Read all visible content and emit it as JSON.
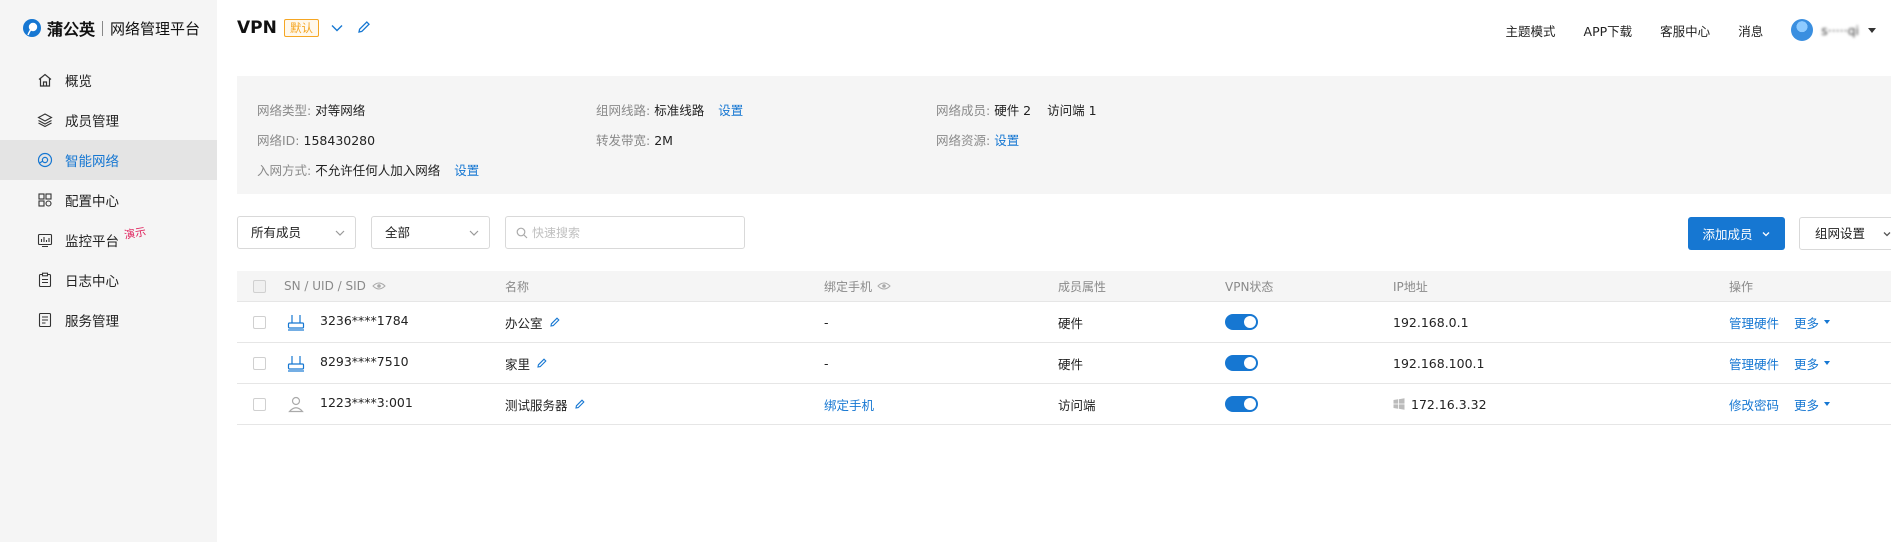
{
  "brand": {
    "name": "蒲公英",
    "subtitle": "网络管理平台"
  },
  "sidebar": {
    "items": [
      {
        "label": "概览",
        "icon": "home-icon"
      },
      {
        "label": "成员管理",
        "icon": "layers-icon"
      },
      {
        "label": "智能网络",
        "icon": "network-icon",
        "active": true
      },
      {
        "label": "配置中心",
        "icon": "grid-icon"
      },
      {
        "label": "监控平台",
        "icon": "monitor-icon",
        "badge": "演示"
      },
      {
        "label": "日志中心",
        "icon": "clipboard-icon"
      },
      {
        "label": "服务管理",
        "icon": "document-icon"
      }
    ]
  },
  "header": {
    "title": "VPN",
    "default_tag": "默认",
    "links": [
      "主题模式",
      "APP下载",
      "客服中心",
      "消息"
    ],
    "user_name": "s·····qi"
  },
  "info": {
    "network_type_label": "网络类型:",
    "network_type_value": "对等网络",
    "network_id_label": "网络ID:",
    "network_id_value": "158430280",
    "join_method_label": "入网方式:",
    "join_method_value": "不允许任何人加入网络",
    "join_method_link": "设置",
    "route_label": "组网线路:",
    "route_value": "标准线路",
    "route_link": "设置",
    "bandwidth_label": "转发带宽:",
    "bandwidth_value": "2M",
    "members_label": "网络成员:",
    "members_hardware": "硬件 2",
    "members_visitor": "访问端 1",
    "resources_label": "网络资源:",
    "resources_link": "设置"
  },
  "filters": {
    "member_select": "所有成员",
    "status_select": "全部",
    "search_placeholder": "快速搜索"
  },
  "actions": {
    "add_member": "添加成员",
    "network_settings": "组网设置"
  },
  "table": {
    "headers": {
      "sn": "SN / UID / SID",
      "name": "名称",
      "phone": "绑定手机",
      "attr": "成员属性",
      "vpn": "VPN状态",
      "ip": "IP地址",
      "ops": "操作"
    },
    "rows": [
      {
        "sn": "3236****1784",
        "name": "办公室",
        "phone": "-",
        "attr": "硬件",
        "vpn": "on",
        "ip": "192.168.0.1",
        "action": "管理硬件",
        "more": "更多",
        "icon": "router-icon"
      },
      {
        "sn": "8293****7510",
        "name": "家里",
        "phone": "-",
        "attr": "硬件",
        "vpn": "on",
        "ip": "192.168.100.1",
        "action": "管理硬件",
        "more": "更多",
        "icon": "router-icon"
      },
      {
        "sn": "1223****3:001",
        "name": "测试服务器",
        "phone": "绑定手机",
        "attr": "访问端",
        "vpn": "on",
        "ip": "172.16.3.32",
        "action": "修改密码",
        "more": "更多",
        "icon": "user-icon"
      }
    ]
  },
  "colors": {
    "accent": "#1677d2",
    "tag": "#f5a623",
    "badge": "#e0245e"
  }
}
